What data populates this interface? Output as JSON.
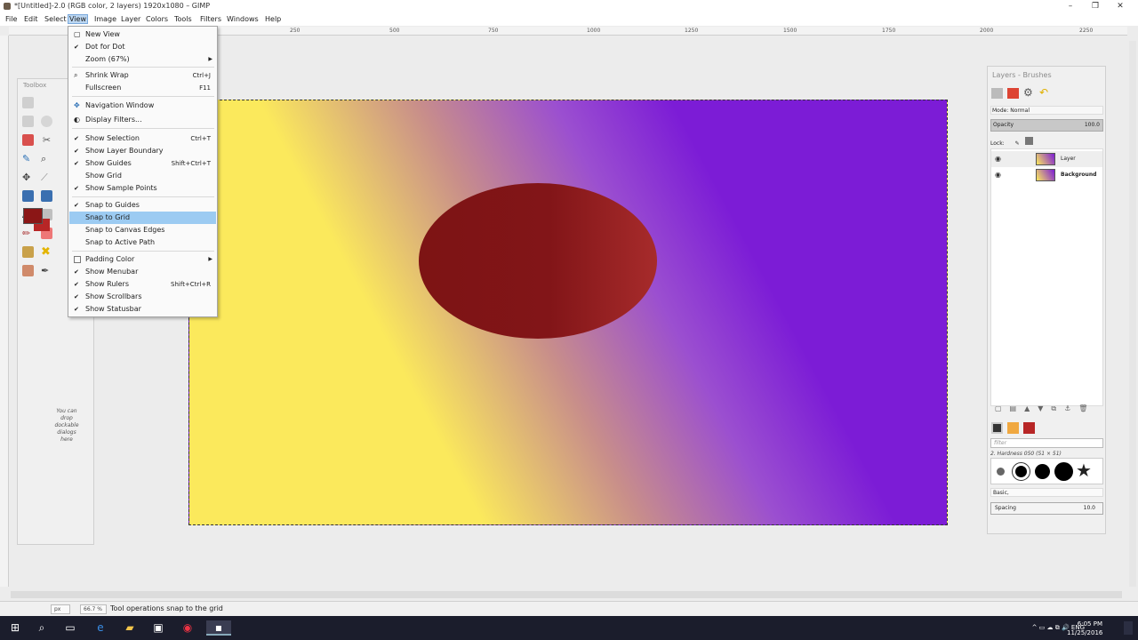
{
  "window": {
    "title": "*[Untitled]-2.0 (RGB color, 2 layers) 1920x1080 – GIMP"
  },
  "menubar": {
    "items": [
      "File",
      "Edit",
      "Select",
      "View",
      "Image",
      "Layer",
      "Colors",
      "Tools",
      "Filters",
      "Windows",
      "Help"
    ],
    "active": "View"
  },
  "ruler": {
    "ticks": [
      "250",
      "500",
      "750",
      "1000",
      "1250",
      "1500",
      "1750",
      "2000",
      "2250"
    ]
  },
  "toolbox": {
    "title": "Toolbox",
    "drop_hint": "You can drop dockable dialogs here"
  },
  "view_menu": {
    "items": [
      {
        "label": "New View",
        "shortcut": "",
        "check": false
      },
      {
        "label": "Dot for Dot",
        "shortcut": "",
        "check": true
      },
      {
        "label": "Zoom (67%)",
        "shortcut": "",
        "check": false,
        "submenu": true
      },
      {
        "label": "Shrink Wrap",
        "shortcut": "Ctrl+J",
        "check": false,
        "icon": "magnifier"
      },
      {
        "label": "Fullscreen",
        "shortcut": "F11",
        "check": false
      },
      {
        "label": "Navigation Window",
        "shortcut": "",
        "check": false,
        "icon": "navigate"
      },
      {
        "label": "Display Filters...",
        "shortcut": "",
        "check": false,
        "icon": "filters"
      },
      {
        "label": "Show Selection",
        "shortcut": "Ctrl+T",
        "check": true
      },
      {
        "label": "Show Layer Boundary",
        "shortcut": "",
        "check": true
      },
      {
        "label": "Show Guides",
        "shortcut": "Shift+Ctrl+T",
        "check": true
      },
      {
        "label": "Show Grid",
        "shortcut": "",
        "check": false
      },
      {
        "label": "Show Sample Points",
        "shortcut": "",
        "check": true
      },
      {
        "label": "Snap to Guides",
        "shortcut": "",
        "check": true
      },
      {
        "label": "Snap to Grid",
        "shortcut": "",
        "check": false,
        "highlighted": true
      },
      {
        "label": "Snap to Canvas Edges",
        "shortcut": "",
        "check": false
      },
      {
        "label": "Snap to Active Path",
        "shortcut": "",
        "check": false
      },
      {
        "label": "Padding Color",
        "shortcut": "",
        "check": false,
        "submenu": true,
        "icon": "swatch"
      },
      {
        "label": "Show Menubar",
        "shortcut": "",
        "check": true
      },
      {
        "label": "Show Rulers",
        "shortcut": "Shift+Ctrl+R",
        "check": true
      },
      {
        "label": "Show Scrollbars",
        "shortcut": "",
        "check": true
      },
      {
        "label": "Show Statusbar",
        "shortcut": "",
        "check": true
      }
    ]
  },
  "layers_dock": {
    "title": "Layers - Brushes",
    "mode": "Mode: Normal",
    "opacity_label": "Opacity",
    "opacity_value": "100.0",
    "lock_label": "Lock:",
    "layers": [
      {
        "name": "Layer",
        "bold": false
      },
      {
        "name": "Background",
        "bold": true
      }
    ],
    "filter_placeholder": "filter",
    "brush_name": "2. Hardness 050 (51 × 51)",
    "preset": "Basic,",
    "spacing_label": "Spacing",
    "spacing_value": "10.0"
  },
  "statusbar": {
    "unit": "px",
    "zoom": "66.7 %",
    "message": "Tool operations snap to the grid"
  },
  "taskbar": {
    "tray": "ENG",
    "time": "6:05 PM",
    "date": "11/25/2016"
  },
  "colors": {
    "foreground": "#8b1616",
    "background": "#b72626",
    "menu_highlight": "#9ccbf2"
  }
}
